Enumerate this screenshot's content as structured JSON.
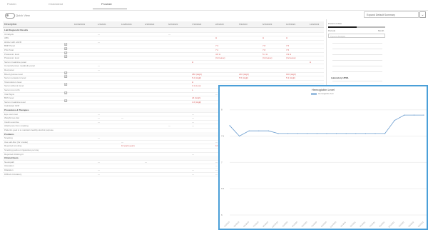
{
  "tabs": [
    {
      "label": "Protein"
    },
    {
      "label": "Cholesterol"
    },
    {
      "label": "Prostate"
    }
  ],
  "toolbar": {
    "toggle_label": "Quick View",
    "select_value": "Expand Default Summary",
    "select_btn": "⌄"
  },
  "table": {
    "header": {
      "description": "Description",
      "dates": [
        "10/18/2019",
        "1/4/2021",
        "11/28/2021",
        "4/18/2022",
        "6/16/2022",
        "7/19/2022",
        "2/6/2023",
        "5/3/2023",
        "6/16/2023",
        "11/5/2023",
        "11/9/2023"
      ]
    },
    "rows": [
      {
        "desc": "Lab Diagnostic Results",
        "section": true
      },
      {
        "desc": "Urinalysis",
        "cells": [
          {
            "col": 1,
            "text": "—"
          },
          {
            "col": 4,
            "text": "—"
          }
        ]
      },
      {
        "desc": "ABG",
        "cells": [
          {
            "col": 6,
            "text": "H",
            "red": true
          },
          {
            "col": 8,
            "text": "H",
            "red": true
          },
          {
            "col": 9,
            "text": "H",
            "red": true
          }
        ]
      },
      {
        "desc": "HbA1c with eGFR",
        "cells": [
          {
            "col": 1,
            "text": "—"
          }
        ]
      },
      {
        "desc": "BMP Panel",
        "check": true,
        "cells": [
          {
            "col": 6,
            "text": "7.3",
            "red": true
          },
          {
            "col": 8,
            "text": "7.8",
            "red": true
          },
          {
            "col": 9,
            "text": "7.5",
            "red": true
          }
        ]
      },
      {
        "desc": "PSA Total",
        "check": true,
        "cells": [
          {
            "col": 6,
            "text": "7.2",
            "red": true
          },
          {
            "col": 8,
            "text": "7.8",
            "red": true
          },
          {
            "col": 9,
            "text": "7.5",
            "red": true
          }
        ]
      },
      {
        "desc": "Potassium level",
        "check": true,
        "cells": [
          {
            "col": 6,
            "text": "4.8 H",
            "red": true
          },
          {
            "col": 8,
            "text": "5.1 H",
            "red": true
          },
          {
            "col": 9,
            "text": "4.9 H",
            "red": true
          }
        ]
      },
      {
        "desc": "Potassium level",
        "check": true,
        "cells": [
          {
            "col": 6,
            "text": "(Increase)",
            "red": true
          },
          {
            "col": 8,
            "text": "(Increase)",
            "red": true
          },
          {
            "col": 9,
            "text": "(Increase)",
            "red": true
          }
        ]
      },
      {
        "desc": "Serum creatinine panel",
        "cells": [
          {
            "col": 5,
            "text": "H",
            "red": true
          },
          {
            "col": 10,
            "text": "H",
            "red": true
          }
        ]
      },
      {
        "desc": "Comprehensive metabolic panel",
        "cells": [
          {
            "col": 1,
            "text": "—"
          }
        ]
      },
      {
        "desc": "Red panel",
        "cells": [
          {
            "col": 1,
            "text": "—"
          }
        ]
      },
      {
        "desc": "Blood glucose level",
        "check": true,
        "cells": [
          {
            "col": 5,
            "text": "180 (High)",
            "red": true
          },
          {
            "col": 7,
            "text": "210 (High)",
            "red": true
          },
          {
            "col": 9,
            "text": "190 (High)",
            "red": true
          }
        ]
      },
      {
        "desc": "Serum potassium level",
        "check": true,
        "cells": [
          {
            "col": 5,
            "text": "5.2 (High)",
            "red": true
          },
          {
            "col": 7,
            "text": "5.5 (High)",
            "red": true
          },
          {
            "col": 9,
            "text": "5.3 (High)",
            "red": true
          }
        ]
      },
      {
        "desc": "Total calcium level",
        "cells": [
          {
            "col": 5,
            "text": "H",
            "red": true
          }
        ]
      },
      {
        "desc": "Serum albumin level",
        "check": true,
        "cells": [
          {
            "col": 5,
            "text": "3.1 (Low)",
            "red": true
          }
        ]
      },
      {
        "desc": "Serum iron LOS",
        "cells": [
          {
            "col": 5,
            "text": "L",
            "red": true
          }
        ]
      },
      {
        "desc": "Vital Signs",
        "check": true,
        "cells": [
          {
            "col": 6,
            "text": "—"
          }
        ]
      },
      {
        "desc": "BUN level",
        "cells": [
          {
            "col": 5,
            "text": "24 (High)",
            "red": true
          }
        ]
      },
      {
        "desc": "Serum creatinine level",
        "check": true,
        "cells": [
          {
            "col": 5,
            "text": "1.6 (High)",
            "red": true
          }
        ]
      },
      {
        "desc": "Calculated GFR",
        "cells": []
      },
      {
        "desc": "Procedures & Therapies",
        "section": true
      },
      {
        "desc": "Eye exam test",
        "cells": [
          {
            "col": 1,
            "text": "—"
          },
          {
            "col": 5,
            "text": "—"
          }
        ]
      },
      {
        "desc": "Weight loss diet",
        "cells": [
          {
            "col": 1,
            "text": "—"
          },
          {
            "col": 2,
            "text": "—"
          },
          {
            "col": 5,
            "text": "—"
          }
        ]
      },
      {
        "desc": "Insulin exercise",
        "cells": [
          {
            "col": 1,
            "text": "—"
          },
          {
            "col": 5,
            "text": "—"
          }
        ]
      },
      {
        "desc": "Abstinence from smoking",
        "cells": [
          {
            "col": 4,
            "text": "—"
          },
          {
            "col": 5,
            "text": "—"
          }
        ]
      },
      {
        "desc": "Patient's goal is to maintain healthy alcohol purpose",
        "cells": []
      },
      {
        "desc": "Problems",
        "section": true
      },
      {
        "desc": "Smoking",
        "cells": [
          {
            "col": 1,
            "text": "—"
          }
        ]
      },
      {
        "desc": "Use salt-bisc (for smoke)",
        "cells": [
          {
            "col": 2,
            "text": "—"
          },
          {
            "col": 6,
            "text": "—"
          }
        ]
      },
      {
        "desc": "Reported smoking",
        "cells": [
          {
            "col": 2,
            "text": "10 pack-years",
            "red": true
          },
          {
            "col": 6,
            "text": "10 pack-years",
            "red": true
          }
        ]
      },
      {
        "desc": "Smoking packs of cigarettes per day",
        "cells": []
      },
      {
        "desc": "Reported drinking ht",
        "cells": [
          {
            "col": 5,
            "text": "—"
          }
        ]
      },
      {
        "desc": "Clinical Exam",
        "section": true
      },
      {
        "desc": "Neuropath",
        "cells": [
          {
            "col": 1,
            "text": "—"
          },
          {
            "col": 3,
            "text": "—"
          },
          {
            "col": 6,
            "text": "—"
          }
        ]
      },
      {
        "desc": "Ulceration",
        "cells": [
          {
            "col": 6,
            "text": "—"
          }
        ]
      },
      {
        "desc": "Dilatation",
        "cells": [
          {
            "col": 1,
            "text": "—"
          },
          {
            "col": 5,
            "text": "—"
          },
          {
            "col": 6,
            "text": "—"
          }
        ]
      },
      {
        "desc": "Difficult circulatory",
        "cells": [
          {
            "col": 1,
            "text": "—"
          },
          {
            "col": 5,
            "text": "—"
          },
          {
            "col": 6,
            "text": "—"
          }
        ]
      }
    ]
  },
  "side": {
    "slider_label": "Preferred date",
    "slider_left": "Periods",
    "slider_right": "Month",
    "slider_level": 0.5,
    "search_placeholder": "Type to Analyze",
    "section_title": "Laboratory HTML"
  },
  "popup": {
    "title": "Hemoglobin Level",
    "legend": "Hemoglobin A1c"
  },
  "chart_data": {
    "type": "line",
    "title": "Hemoglobin Level",
    "series": [
      {
        "name": "Hemoglobin A1c",
        "values": [
          7.7,
          7.5,
          7.6,
          7.6,
          7.6,
          7.55,
          7.55,
          7.55,
          7.55,
          7.55,
          7.55,
          7.55,
          7.55,
          7.55,
          7.55,
          7.55,
          7.55,
          7.8,
          7.9,
          7.9,
          7.9
        ]
      }
    ],
    "yticks": [
      "8",
      "7.5",
      "7",
      "6.5",
      "6"
    ],
    "ylim": [
      6,
      8.2
    ],
    "xticks": [
      "1/1/2019",
      "3/1/2019",
      "5/1/2019",
      "7/1/2019",
      "9/1/2019",
      "11/1/2019",
      "1/1/2020",
      "3/1/2020",
      "5/1/2020",
      "7/1/2020",
      "9/1/2020",
      "11/1/2020",
      "1/1/2021",
      "3/1/2021",
      "5/1/2021",
      "7/1/2021",
      "9/1/2021",
      "11/1/2021",
      "1/1/2022",
      "3/1/2022",
      "5/1/2022"
    ],
    "colors": {
      "line": "#6a9ccf"
    }
  }
}
